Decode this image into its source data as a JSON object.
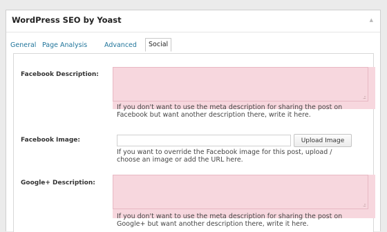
{
  "metabox": {
    "title": "WordPress SEO by Yoast",
    "collapse_glyph": "▲"
  },
  "tabs": [
    {
      "label": "General",
      "active": false
    },
    {
      "label": "Page Analysis",
      "active": false
    },
    {
      "label": "Advanced",
      "active": false
    },
    {
      "label": "Social",
      "active": true
    }
  ],
  "fields": {
    "facebook_description": {
      "label": "Facebook Description:",
      "value": "",
      "help_line1": "If you don't want to use the meta description for sharing the post on",
      "help_line2": "Facebook but want another description there, write it here."
    },
    "facebook_image": {
      "label": "Facebook Image:",
      "value": "",
      "button_label": "Upload Image",
      "help_line1": "If you want to override the Facebook image for this post, upload /",
      "help_line2": "choose an image or add the URL here."
    },
    "google_description": {
      "label": "Google+ Description:",
      "value": "",
      "help_line1": "If you don't want to use the meta description for sharing the post on",
      "help_line2": "Google+ but want another description there, write it here."
    }
  },
  "colors": {
    "link": "#21759b",
    "highlight": "#f7d7de",
    "panel_bg": "#ffffff",
    "page_bg": "#ebebeb"
  }
}
